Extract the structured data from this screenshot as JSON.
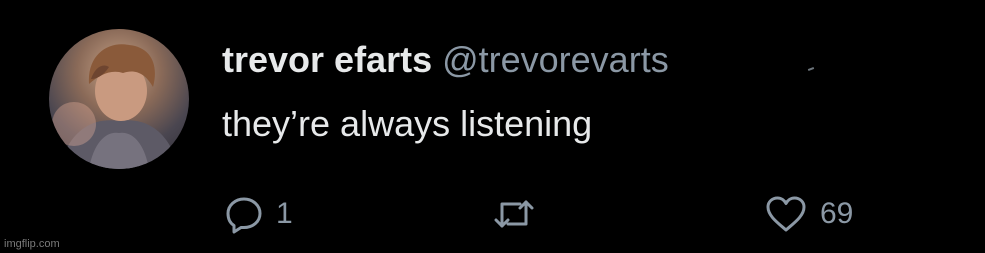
{
  "tweet": {
    "display_name": "trevor efarts",
    "handle": "@trevorevarts",
    "text": "they’re always listening"
  },
  "actions": {
    "reply": {
      "icon": "reply-icon",
      "count": "1"
    },
    "retweet": {
      "icon": "retweet-icon",
      "count": ""
    },
    "like": {
      "icon": "heart-icon",
      "count": "69"
    }
  },
  "watermark": "imgflip.com",
  "colors": {
    "background": "#000000",
    "text_primary": "#e7e9ea",
    "text_secondary": "#8b98a5"
  }
}
